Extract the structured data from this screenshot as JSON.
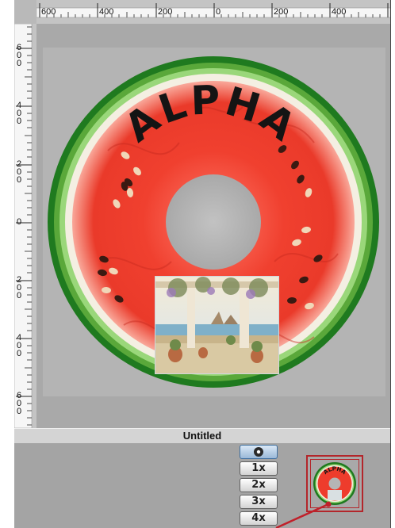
{
  "window": {
    "title": "Untitled"
  },
  "ruler": {
    "horizontal_labels": [
      "600",
      "400",
      "200",
      "0",
      "200",
      "400"
    ],
    "vertical_labels": [
      "600",
      "400",
      "200",
      "0",
      "200",
      "400",
      "600"
    ]
  },
  "disc": {
    "title_text": "ALPHA"
  },
  "zoom": {
    "buttons": [
      "",
      "1x",
      "2x",
      "3x",
      "4x"
    ]
  },
  "colors": {
    "rind_dark": "#1f7a1f",
    "rind_light": "#8fd070",
    "pith": "#f4efe2",
    "flesh": "#ee3c2c",
    "hole": "#b5b5b5",
    "canvas": "#a9a9a9",
    "thumb_frame": "#b3262b"
  }
}
